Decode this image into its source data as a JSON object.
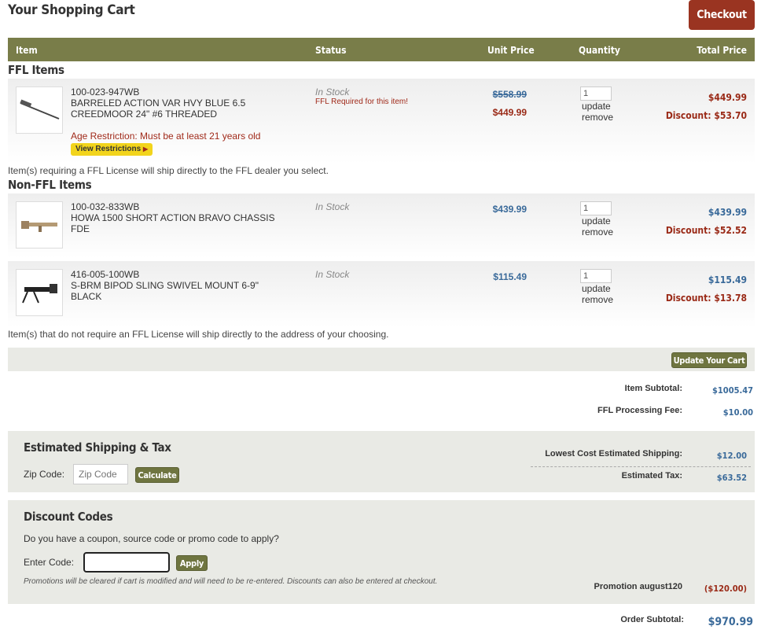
{
  "page": {
    "title": "Your Shopping Cart",
    "checkout_label": "Checkout"
  },
  "table_header": {
    "item": "Item",
    "status": "Status",
    "unit_price": "Unit Price",
    "quantity": "Quantity",
    "total_price": "Total Price"
  },
  "ffl": {
    "section_title": "FFL Items",
    "items": [
      {
        "sku": "100-023-947WB",
        "name": "BARRELED ACTION VAR HVY BLUE 6.5 CREEDMOOR 24\" #6 THREADED",
        "status": "In Stock",
        "status_note": "FFL Required for this item!",
        "original_price": "$558.99",
        "unit_price": "$449.99",
        "qty": "1",
        "update": "update",
        "remove": "remove",
        "total": "$449.99",
        "discount": "Discount: $53.70",
        "age_restriction": "Age Restriction: Must be at least 21 years old",
        "restrictions_button": "View Restrictions",
        "image": "rifle-barreled-action-icon"
      }
    ],
    "note": "Item(s) requiring a FFL License will ship directly to the FFL dealer you select."
  },
  "nonffl": {
    "section_title": "Non-FFL Items",
    "items": [
      {
        "sku": "100-032-833WB",
        "name": "HOWA 1500 SHORT ACTION BRAVO CHASSIS FDE",
        "status": "In Stock",
        "unit_price": "$439.99",
        "qty": "1",
        "update": "update",
        "remove": "remove",
        "total": "$439.99",
        "discount": "Discount: $52.52",
        "image": "rifle-chassis-icon"
      },
      {
        "sku": "416-005-100WB",
        "name": "S-BRM BIPOD SLING SWIVEL MOUNT 6-9\" BLACK",
        "status": "In Stock",
        "unit_price": "$115.49",
        "qty": "1",
        "update": "update",
        "remove": "remove",
        "total": "$115.49",
        "discount": "Discount: $13.78",
        "image": "bipod-icon"
      }
    ],
    "note": "Item(s) that do not require an FFL License will ship directly to the address of your choosing."
  },
  "update_cart_label": "Update Your Cart",
  "summary": {
    "item_subtotal_label": "Item Subtotal:",
    "item_subtotal": "$1005.47",
    "ffl_fee_label": "FFL Processing Fee:",
    "ffl_fee": "$10.00"
  },
  "shipping": {
    "title": "Estimated Shipping & Tax",
    "zip_label": "Zip Code:",
    "zip_placeholder": "Zip Code",
    "calculate_label": "Calculate",
    "shipping_label": "Lowest Cost Estimated Shipping:",
    "shipping_value": "$12.00",
    "tax_label": "Estimated Tax:",
    "tax_value": "$63.52"
  },
  "discount": {
    "title": "Discount Codes",
    "question": "Do you have a coupon, source code or promo code to apply?",
    "code_label": "Enter Code:",
    "apply_label": "Apply",
    "disclaimer": "Promotions will be cleared if cart is modified and will need to be re-entered. Discounts can also be entered at checkout.",
    "promotion_label": "Promotion august120",
    "promotion_value": "($120.00)"
  },
  "order": {
    "subtotal_label": "Order Subtotal:",
    "subtotal": "$970.99"
  },
  "colors": {
    "header_olive": "#797d49",
    "checkout_red": "#9a3421",
    "price_blue": "#3a6a9a",
    "discount_red": "#9a2a17",
    "restrict_yellow": "#f2d41c"
  }
}
